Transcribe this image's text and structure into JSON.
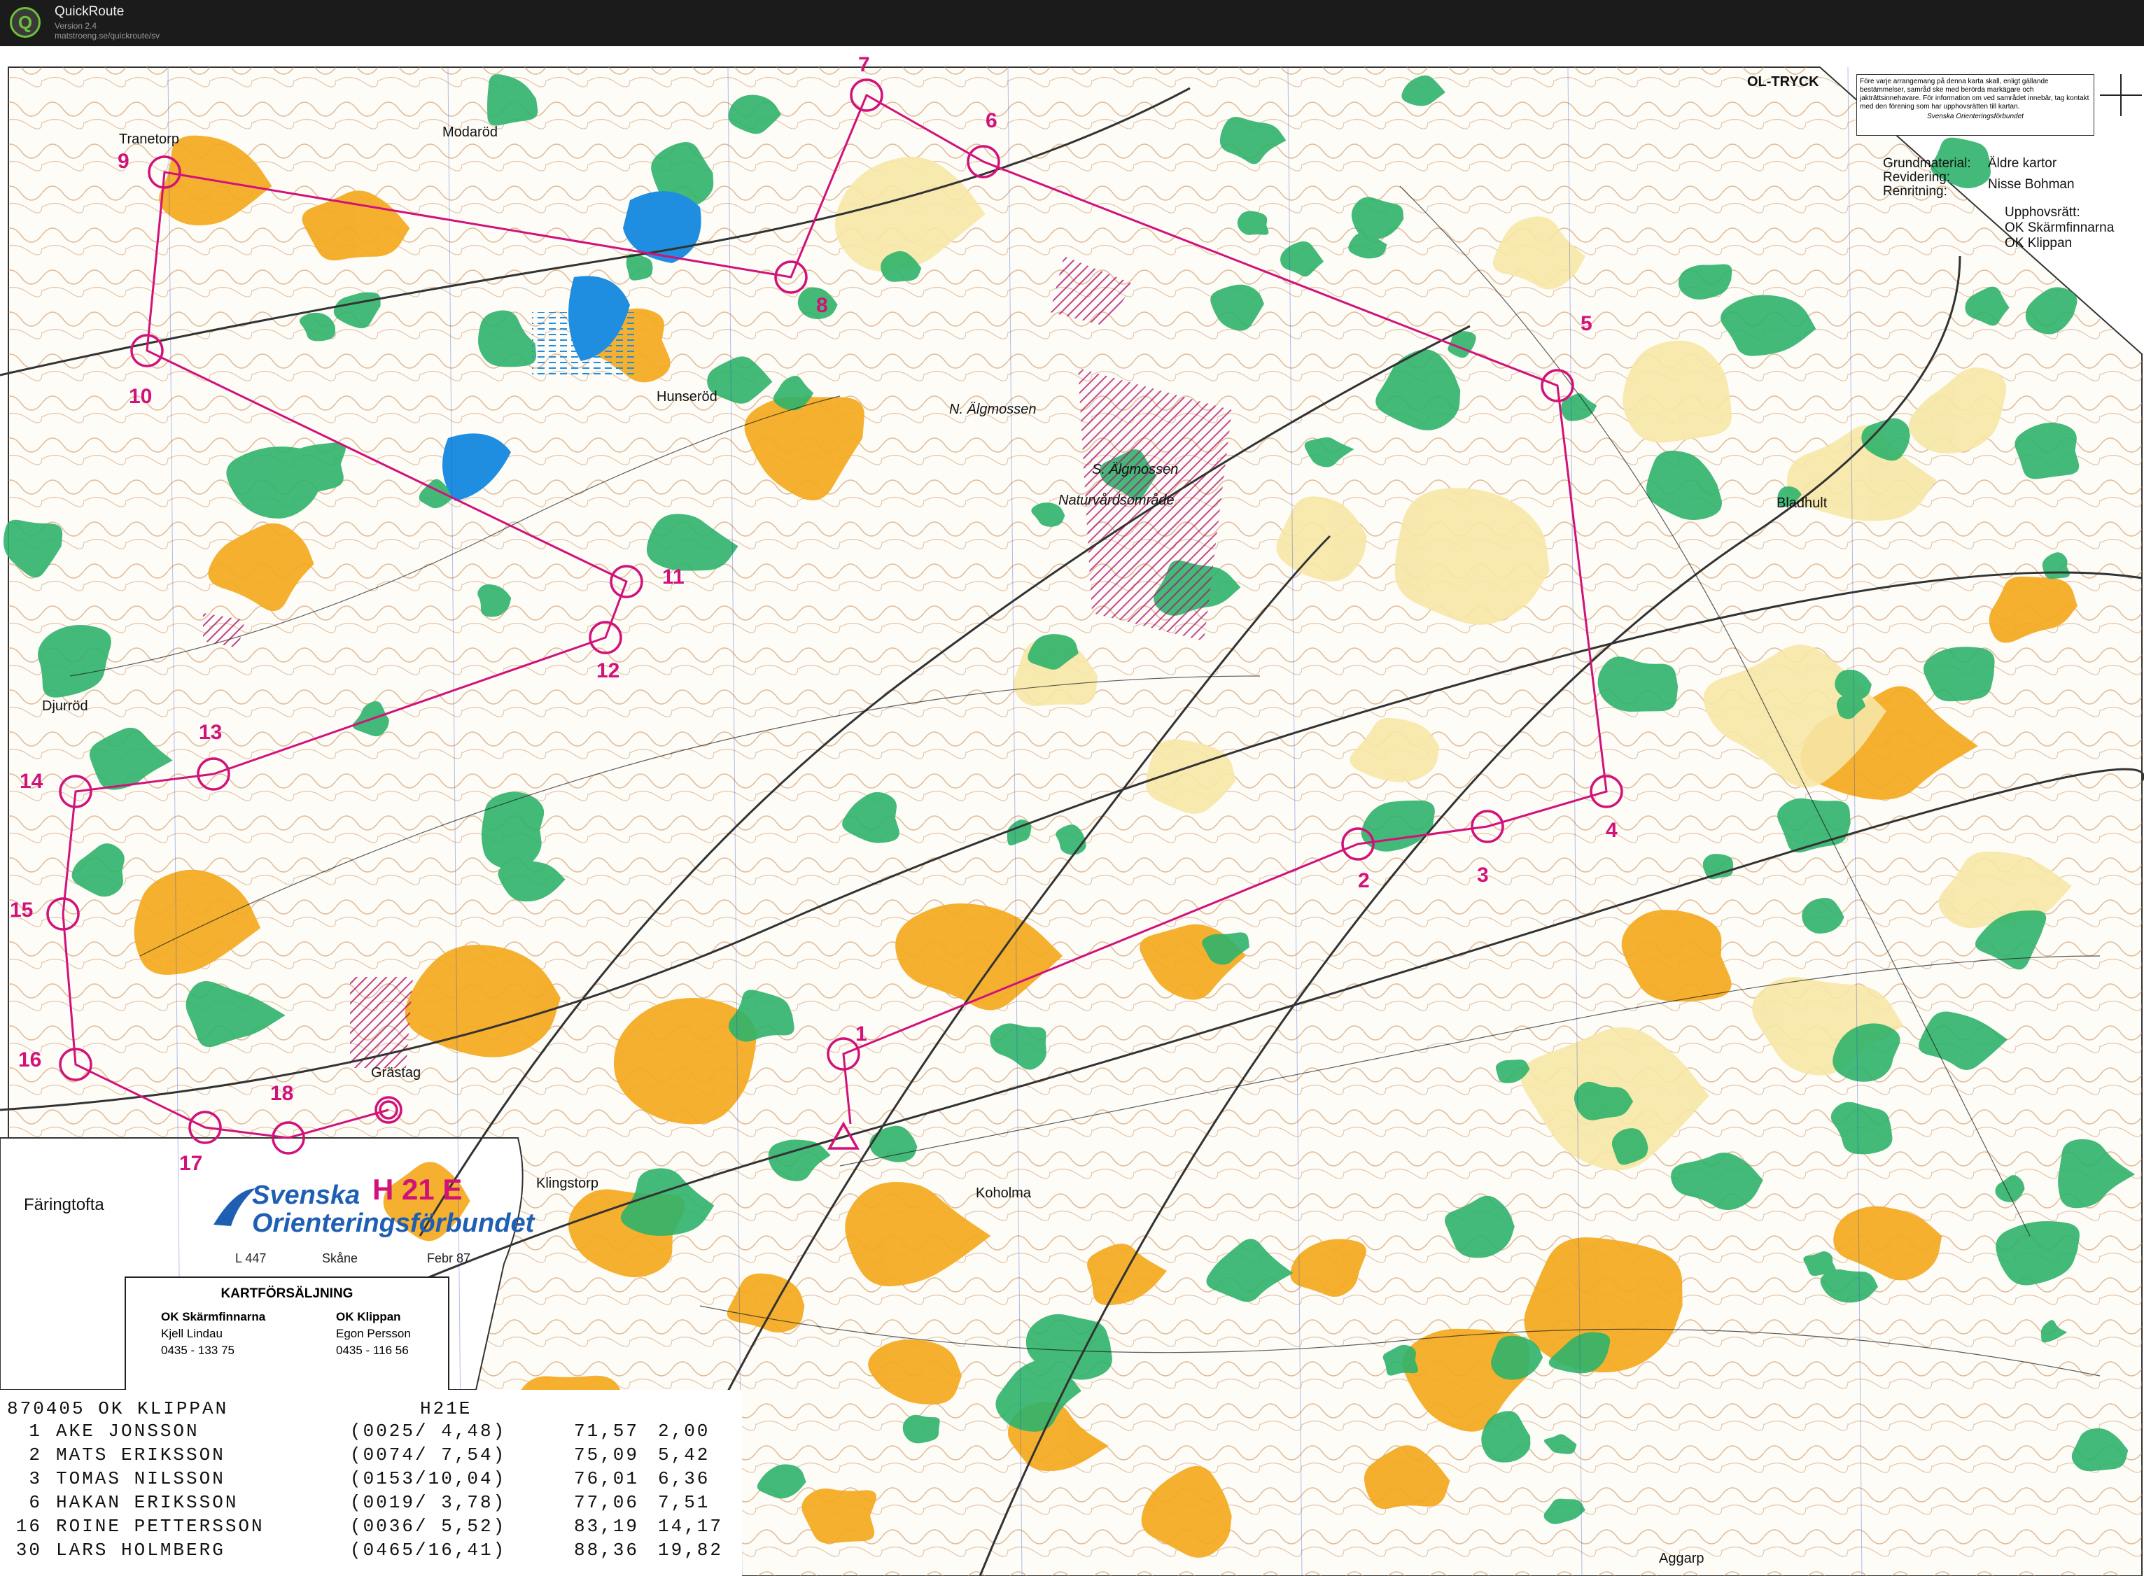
{
  "app": {
    "name": "QuickRoute",
    "version": "Version 2.4",
    "url": "matstroeng.se/quickroute/sv"
  },
  "colors": {
    "forest_green": "#2fb36a",
    "open_yellow": "#f4a91d",
    "light_yellow": "#f7e7a6",
    "water_blue": "#1f8ee0",
    "course_magenta": "#d1127a",
    "contour_brown": "#c8844a"
  },
  "map": {
    "place_names": {
      "modarod": "Modaröd",
      "tranetorp": "Tranetorp",
      "hunserod": "Hunseröd",
      "n_algmossen": "N. Älgmossen",
      "s_algmossen": "S. Älgmossen",
      "naturvard": "Naturvårdsområde",
      "bladhult": "Bladhult",
      "djurrod": "Djurröd",
      "grastag": "Grästag",
      "faringtofta": "Färingtofta",
      "klingstorp": "Klingstorp",
      "koholma": "Koholma",
      "aggarp": "Aggarp"
    },
    "control_labels": [
      "1",
      "2",
      "3",
      "4",
      "5",
      "6",
      "7",
      "8",
      "9",
      "10",
      "11",
      "12",
      "13",
      "14",
      "15",
      "16",
      "17",
      "18"
    ],
    "course_tag": "H 21 E",
    "ol_tryck": "OL-TRYCK",
    "legal_notice": "Före varje arrangemang på denna karta skall, enligt gällande bestämmelser, samråd ske med berörda markägare och jakträttsinnehavare. För information om ved samrådet innebär, tag kontakt med den förening som har upphovsrätten till kartan.",
    "legal_sig": "Svenska Orienteringsförbundet",
    "credits": {
      "grund_label": "Grundmaterial:",
      "grund_value": "Äldre kartor",
      "revid_label": "Revidering:",
      "renrit_label": "Renritning:",
      "renrit_value": "Nisse Bohman",
      "upphov_label": "Upphovsrätt:",
      "upphov_1": "OK Skärmfinnarna",
      "upphov_2": "OK Klippan"
    },
    "sponsor": {
      "line1": "Svenska",
      "line2": "Orienteringsförbundet",
      "map_no": "L 447",
      "region": "Skåne",
      "date": "Febr 87"
    },
    "kartforsaljning": {
      "title": "KARTFÖRSÄLJNING",
      "club1": "OK Skärmfinnarna",
      "name1": "Kjell Lindau",
      "phone1": "0435 - 133 75",
      "club2": "OK Klippan",
      "name2": "Egon Persson",
      "phone2": "0435 - 116 56"
    }
  },
  "results": {
    "header_left": "870405 OK KLIPPAN",
    "header_right": "H21E",
    "rows": [
      {
        "place": "1",
        "name": "AKE JONSSON",
        "split": "(0025/ 4,48)",
        "time": "71,57",
        "diff": "2,00"
      },
      {
        "place": "2",
        "name": "MATS ERIKSSON",
        "split": "(0074/ 7,54)",
        "time": "75,09",
        "diff": "5,42"
      },
      {
        "place": "3",
        "name": "TOMAS NILSSON",
        "split": "(0153/10,04)",
        "time": "76,01",
        "diff": "6,36"
      },
      {
        "place": "6",
        "name": "HAKAN ERIKSSON",
        "split": "(0019/ 3,78)",
        "time": "77,06",
        "diff": "7,51"
      },
      {
        "place": "16",
        "name": "ROINE PETTERSSON",
        "split": "(0036/ 5,52)",
        "time": "83,19",
        "diff": "14,17"
      },
      {
        "place": "30",
        "name": "LARS HOLMBERG",
        "split": "(0465/16,41)",
        "time": "88,36",
        "diff": "19,82"
      }
    ]
  }
}
